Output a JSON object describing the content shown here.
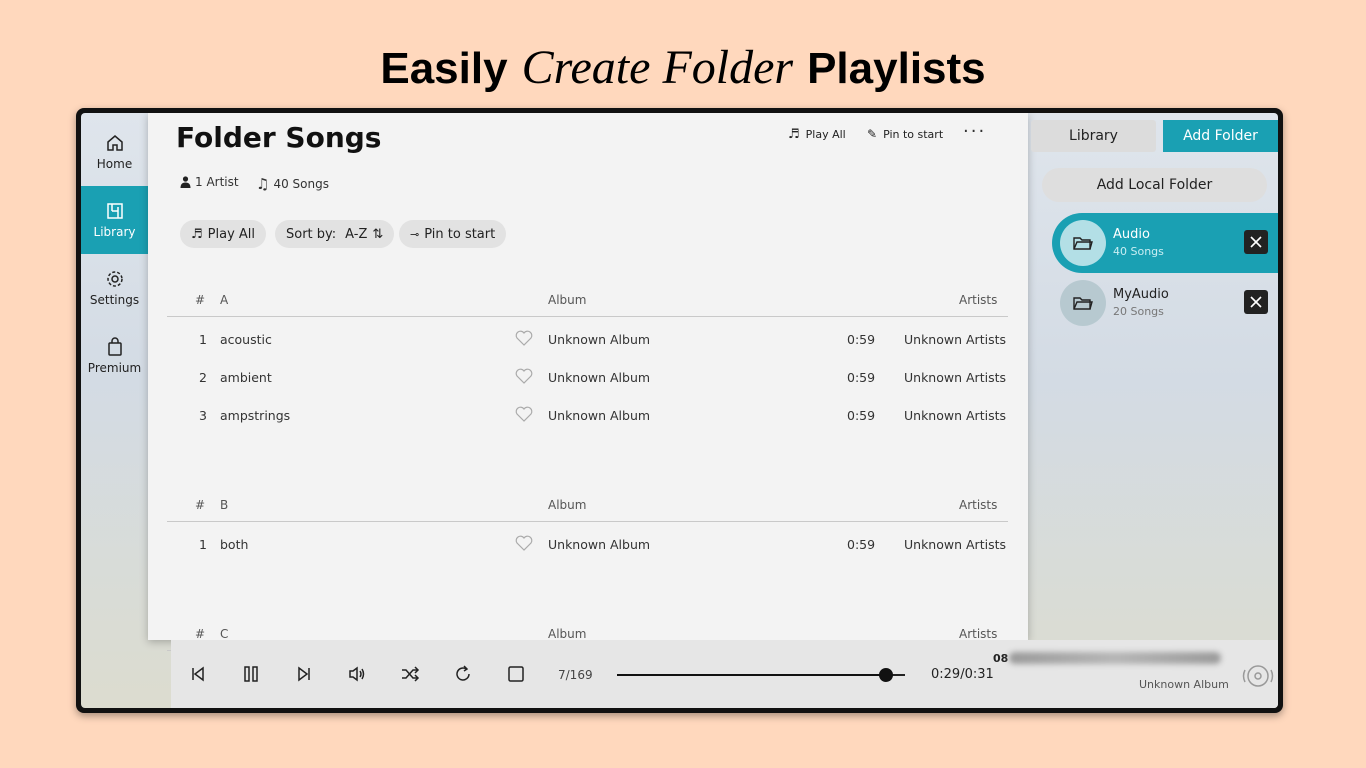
{
  "headline": {
    "part1": "Easily",
    "part2": "Create Folder",
    "part3": "Playlists"
  },
  "nav": [
    {
      "label": "Home"
    },
    {
      "label": "Library"
    },
    {
      "label": "Settings"
    },
    {
      "label": "Premium"
    }
  ],
  "main": {
    "title": "Folder Songs",
    "artists": "1 Artist",
    "songs": "40 Songs",
    "top_play_all": "Play All",
    "top_pin": "Pin to start",
    "more": "···",
    "play_all": "Play All",
    "sort_label": "Sort by:",
    "sort_value": "A-Z",
    "pin": "Pin to start"
  },
  "sections": [
    {
      "hash": "#",
      "letter": "A",
      "album_col": "Album",
      "artists_col": "Artists",
      "rows": [
        {
          "num": "1",
          "title": "acoustic",
          "album": "Unknown Album",
          "duration": "0:59",
          "artist": "Unknown Artists"
        },
        {
          "num": "2",
          "title": "ambient",
          "album": "Unknown Album",
          "duration": "0:59",
          "artist": "Unknown Artists"
        },
        {
          "num": "3",
          "title": "ampstrings",
          "album": "Unknown Album",
          "duration": "0:59",
          "artist": "Unknown Artists"
        }
      ]
    },
    {
      "hash": "#",
      "letter": "B",
      "album_col": "Album",
      "artists_col": "Artists",
      "rows": [
        {
          "num": "1",
          "title": "both",
          "album": "Unknown Album",
          "duration": "0:59",
          "artist": "Unknown Artists"
        }
      ]
    },
    {
      "hash": "#",
      "letter": "C",
      "album_col": "Album",
      "artists_col": "Artists",
      "rows": []
    }
  ],
  "right": {
    "tab_library": "Library",
    "tab_add_folder": "Add Folder",
    "add_local": "Add Local Folder",
    "folders": [
      {
        "name": "Audio",
        "count": "40 Songs"
      },
      {
        "name": "MyAudio",
        "count": "20 Songs"
      }
    ]
  },
  "player": {
    "track_count": "7/169",
    "time": "0:29/0:31",
    "progress": 0.935,
    "now_playing_number": "08",
    "album": "Unknown Album"
  },
  "colors": {
    "accent": "#1aa0b3",
    "background": "#ffd8bd"
  }
}
